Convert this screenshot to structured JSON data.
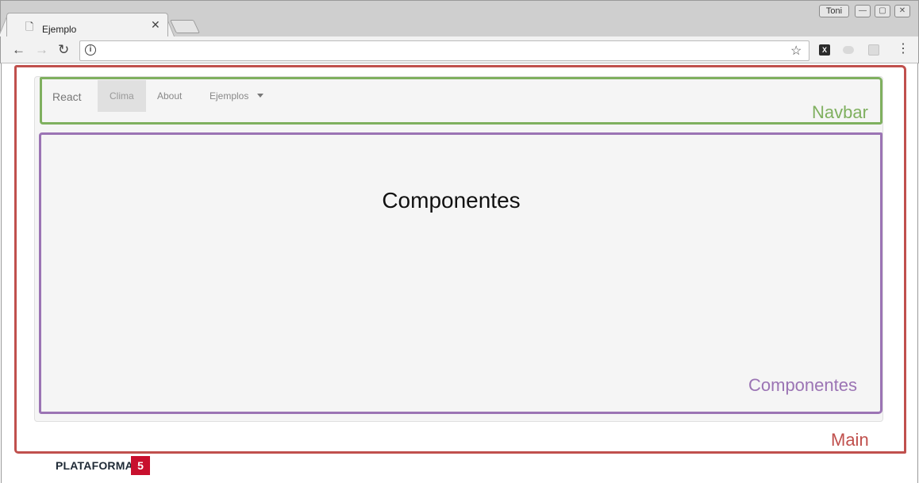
{
  "browser": {
    "tab_title": "Ejemplo",
    "tab_close": "✕",
    "user_name": "Toni",
    "window_buttons": [
      "—",
      "▢",
      "✕"
    ],
    "nav": {
      "back": "←",
      "forward": "→",
      "reload": "↻"
    },
    "info_glyph": "i",
    "star": "☆",
    "menu": "⋮",
    "extensions": [
      {
        "icon": "x-extension-icon",
        "color": "#2b2b2b"
      },
      {
        "icon": "pill-extension-icon",
        "color": "#cfcfcf"
      },
      {
        "icon": "grid-extension-icon",
        "color": "#d8d8d8"
      }
    ]
  },
  "navbar": {
    "brand": "React",
    "items": [
      {
        "label": "Clima",
        "active": true
      },
      {
        "label": "About",
        "active": false
      },
      {
        "label": "Ejemplos",
        "active": false,
        "dropdown": true
      }
    ]
  },
  "main": {
    "heading": "Componentes"
  },
  "annotations": {
    "navbar": {
      "label": "Navbar",
      "color": "#7fb05f"
    },
    "components": {
      "label": "Componentes",
      "color": "#9b74b4"
    },
    "main": {
      "label": "Main",
      "color": "#c0504d"
    }
  },
  "footer": {
    "logo_text": "PLATAFORMA",
    "logo_number": "5",
    "logo_color": "#c8102e"
  }
}
